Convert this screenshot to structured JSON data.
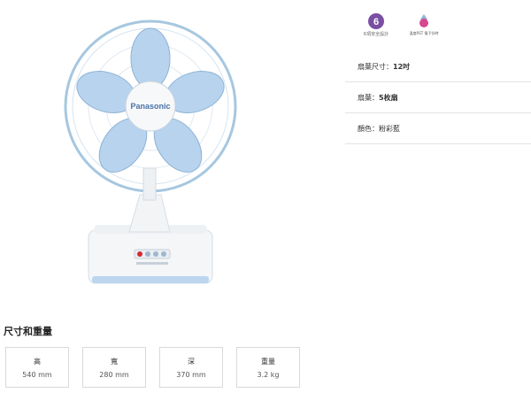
{
  "product": {
    "brand": "Panasonic",
    "image_alt": "Panasonic 12吋 desk fan, white with light blue blades"
  },
  "badges": [
    {
      "icon": "six-safety-badge-icon",
      "label": "6項安全設計"
    },
    {
      "icon": "nanoe-badge-icon",
      "label": "溫度RST 電子計時"
    }
  ],
  "specs": [
    {
      "label": "扇葉尺寸：",
      "value": "12吋"
    },
    {
      "label": "扇葉：",
      "value": "5枚扇"
    },
    {
      "label": "顏色：",
      "value": "粉彩藍"
    }
  ],
  "dimensions": {
    "title": "尺寸和重量",
    "items": [
      {
        "label": "高",
        "value": "540 mm"
      },
      {
        "label": "寬",
        "value": "280 mm"
      },
      {
        "label": "深",
        "value": "370 mm"
      },
      {
        "label": "重量",
        "value": "3.2 kg"
      }
    ]
  },
  "colors": {
    "blade": "#b7d3ee",
    "accent_purple": "#7a4fa3",
    "accent_pink": "#d64790"
  }
}
